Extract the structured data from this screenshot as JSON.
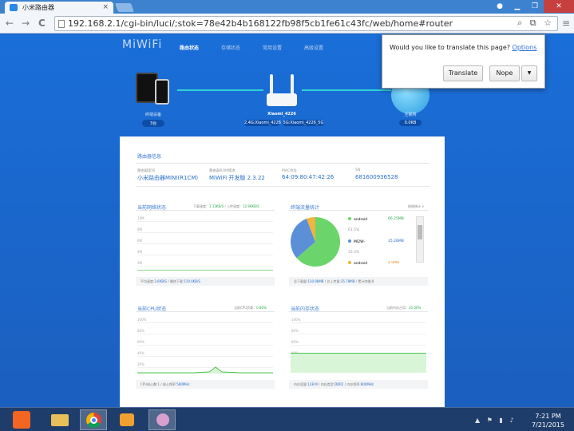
{
  "browser": {
    "tab_title": "小米路由器",
    "url": "192.168.2.1/cgi-bin/luci/;stok=78e42b4b168122fb98f5cb1fe61c43fc/web/home#router",
    "close_tab": "×",
    "minimize": "▁",
    "restore": "❐",
    "close": "✕",
    "back": "←",
    "forward": "→",
    "reload": "C",
    "menu": "≡",
    "omni_icons": "⌕ ⧉ ☆",
    "user": "●"
  },
  "translate": {
    "question": "Would you like to translate this page?",
    "options": "Options",
    "translate_btn": "Translate",
    "nope_btn": "Nope",
    "caret": "▼"
  },
  "header": {
    "logo": "MiWiFi",
    "nav": [
      "路由状态",
      "存储状态",
      "常用设置",
      "高级设置"
    ]
  },
  "topology": {
    "left_device_label": "终端设备",
    "left_device_count": "3台",
    "router_name": "Xiaomi_4226",
    "wifi_24": "2.4G:Xiaomi_4226",
    "wifi_5": "5G:Xiaomi_4226_5G",
    "internet_label": "互联网",
    "internet_speed": "0.0KB"
  },
  "router_info": {
    "title": "路由器信息",
    "fields": [
      {
        "label": "路由器型号",
        "value": "小米路由器MINI(R1CM)"
      },
      {
        "label": "路由器ROM版本",
        "value": "MiWiFi 开发版 2.3.22"
      },
      {
        "label": "MAC地址",
        "value": "64:09:80:47:42:26"
      },
      {
        "label": "SN",
        "value": "681600936528"
      }
    ]
  },
  "network": {
    "title": "当前网络状态",
    "down_label": "下载速度：",
    "down_value": "1.13KB/S",
    "up_label": "上传速度：",
    "up_value": "12.96KB/S",
    "y_labels": [
      "10M",
      "8M",
      "6M",
      "4M",
      "2M"
    ],
    "footer_avg_label": "平均速度:",
    "footer_avg": "3.6KB/S",
    "footer_max_label": "最快下载:",
    "footer_max": "119.0KB/S"
  },
  "traffic": {
    "title": "终端流量统计",
    "more": "按周统计 ∨",
    "legend": [
      {
        "name": "android",
        "value": "66.25MB",
        "pct": "61.5%",
        "color": "#6bd56b"
      },
      {
        "name": "MI2W-",
        "value": "35.28MB",
        "pct": "33.3%",
        "color": "#5b8fd8"
      },
      {
        "name": "android",
        "value": "4.9MB",
        "pct": "",
        "color": "#f2b43c"
      }
    ],
    "footer_down_label": "总下载量:",
    "footer_down": "130.98MB",
    "footer_up_label": "总上传量:",
    "footer_up": "35.78MB",
    "footer_cnt_label": "累计终端:",
    "footer_cnt": "8"
  },
  "chart_data": [
    {
      "type": "pie",
      "title": "终端流量统计",
      "categories": [
        "android",
        "MI2W-",
        "android"
      ],
      "values": [
        61.5,
        33.3,
        5.2
      ]
    }
  ],
  "cpu": {
    "title": "当前CPU状态",
    "load_label": "当前CPU负载：",
    "load_value": "0.80%",
    "y_labels": [
      "100%",
      "80%",
      "60%",
      "40%",
      "20%"
    ],
    "footer_cores_label": "CPU核心数:",
    "footer_cores": "1",
    "footer_freq_label": "核心频率:",
    "footer_freq": "580MHz"
  },
  "memory": {
    "title": "当前内存状态",
    "usage_label": "当前内存占用：",
    "usage_value": "35.00%",
    "y_labels": [
      "100%",
      "80%",
      "60%",
      "40%",
      "20%"
    ],
    "footer_cap_label": "内存容量:",
    "footer_cap": "128 M",
    "footer_type_label": "内存类型:",
    "footer_type": "DDR2",
    "footer_freq_label": "内存频率:",
    "footer_freq": "800MHz"
  },
  "taskbar": {
    "time": "7:21 PM",
    "date": "7/21/2015"
  }
}
